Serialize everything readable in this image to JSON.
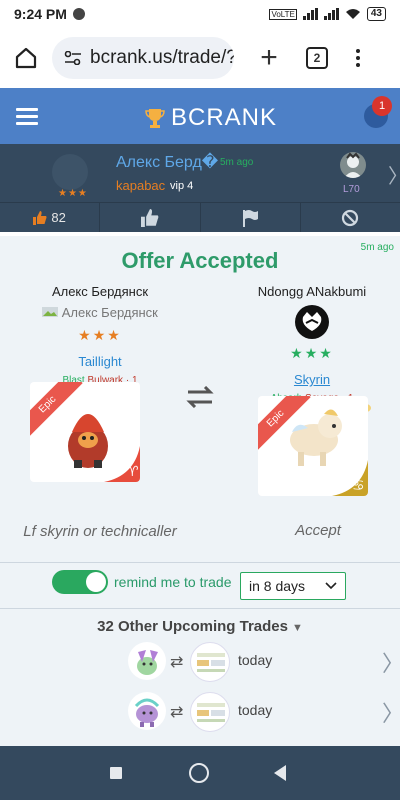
{
  "status_bar": {
    "time": "9:24 PM",
    "network": "VoLTE",
    "battery": "43"
  },
  "browser": {
    "url": "bcrank.us/trade/?",
    "tab_count": "2"
  },
  "site_header": {
    "brand": "BCRANK",
    "notification_count": "1"
  },
  "poster": {
    "name": "Алекс Берд�",
    "time": "5m ago",
    "subtitle": "kapabac",
    "vip": "vip 4",
    "stars": "★★★",
    "level": "L70"
  },
  "actions": {
    "likes": "82"
  },
  "offer": {
    "time": "5m ago",
    "title": "Offer Accepted",
    "left": {
      "user_name": "Алекс Бердянск",
      "alt_text": "Алекс Бердянск",
      "stars": "★★★",
      "monster_name": "Taillight",
      "trait_1": "Blast",
      "trait_2": "Bulwark",
      "level_suffix": "· 1",
      "rarity": "Epic",
      "comment": "Lf skyrin or technicaller"
    },
    "right": {
      "user_name": "Ndongg ANakbumi",
      "stars": "★★★",
      "monster_name": "Skyrin",
      "trait_1": "Absorb",
      "trait_2": "Savage",
      "level_suffix": "· 1",
      "rarity": "Epic",
      "comment": "Accept"
    }
  },
  "reminder": {
    "label": "remind me to trade",
    "enabled": true,
    "selected": "in 8 days"
  },
  "upcoming": {
    "title": "32 Other Upcoming Trades",
    "rows": [
      {
        "when": "today"
      },
      {
        "when": "today"
      }
    ]
  },
  "colors": {
    "header_blue": "#4d80c7",
    "dark_panel": "#34495e",
    "accepted_green": "#2e9b6a",
    "star_orange": "#e67e22",
    "star_green": "#27ae60",
    "epic_red": "#e9574d"
  }
}
